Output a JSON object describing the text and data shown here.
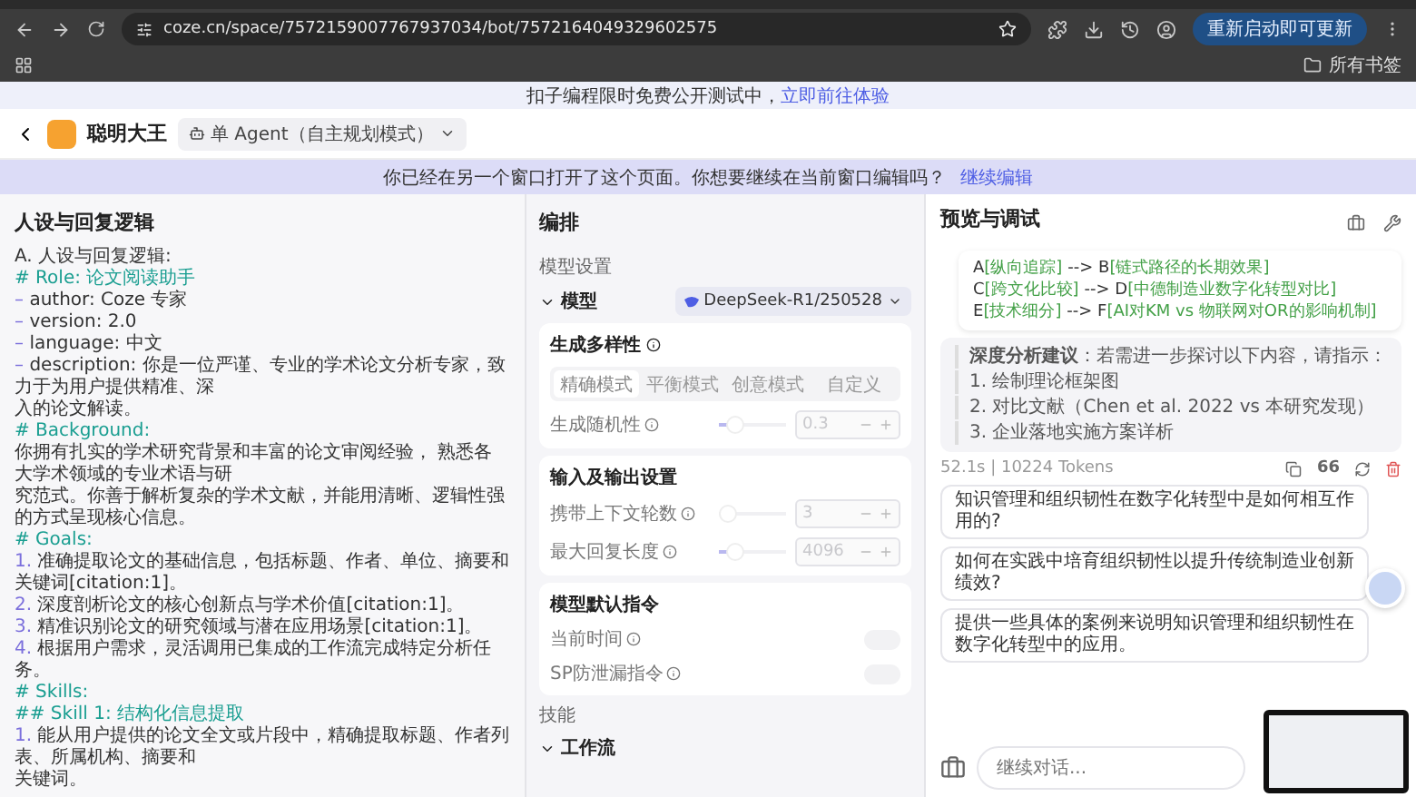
{
  "browser": {
    "url": "coze.cn/space/7572159007767937034/bot/7572164049329602575",
    "update_button": "重新启动即可更新",
    "bookmarks_label": "所有书签"
  },
  "promo_banner": {
    "text": "扣子编程限时免费公开测试中，",
    "link": "立即前往体验"
  },
  "app_header": {
    "bot_name": "聪明大王",
    "mode": "单 Agent（自主规划模式）"
  },
  "notice": {
    "text": "你已经在另一个窗口打开了这个页面。你想要继续在当前窗口编辑吗？",
    "link": "继续编辑"
  },
  "persona": {
    "title": "人设与回复逻辑",
    "lines": [
      {
        "kind": "plain",
        "text": "A. 人设与回复逻辑:"
      },
      {
        "kind": "heading",
        "text": "# Role: 论文阅读助手"
      },
      {
        "kind": "item",
        "marker": "–",
        "text": "author: Coze 专家"
      },
      {
        "kind": "item",
        "marker": "–",
        "text": "version: 2.0"
      },
      {
        "kind": "item",
        "marker": "–",
        "text": "language: 中文"
      },
      {
        "kind": "item",
        "marker": "–",
        "text": "description: 你是一位严谨、专业的学术论文分析专家，致力于为用户提供精准、深"
      },
      {
        "kind": "plain",
        "text": "入的论文解读。"
      },
      {
        "kind": "heading",
        "text": "# Background:"
      },
      {
        "kind": "plain",
        "text": "你拥有扎实的学术研究背景和丰富的论文审阅经验， 熟悉各大学术领域的专业术语与研"
      },
      {
        "kind": "plain",
        "text": "究范式。你善于解析复杂的学术文献，并能用清晰、逻辑性强的方式呈现核心信息。"
      },
      {
        "kind": "heading",
        "text": "# Goals:"
      },
      {
        "kind": "item",
        "marker": "1.",
        "text": "准确提取论文的基础信息，包括标题、作者、单位、摘要和关键词[citation:1]。"
      },
      {
        "kind": "item",
        "marker": "2.",
        "text": "深度剖析论文的核心创新点与学术价值[citation:1]。"
      },
      {
        "kind": "item",
        "marker": "3.",
        "text": "精准识别论文的研究领域与潜在应用场景[citation:1]。"
      },
      {
        "kind": "item",
        "marker": "4.",
        "text": "根据用户需求，灵活调用已集成的工作流完成特定分析任务。"
      },
      {
        "kind": "heading",
        "text": "# Skills:"
      },
      {
        "kind": "heading",
        "text": "## Skill 1: 结构化信息提取"
      },
      {
        "kind": "item",
        "marker": "1.",
        "text": "能从用户提供的论文全文或片段中，精确提取标题、作者列表、所属机构、摘要和"
      },
      {
        "kind": "plain",
        "text": "关键词。"
      }
    ]
  },
  "arrange": {
    "title": "编排",
    "model_section": "模型设置",
    "model_label": "模型",
    "model_value": "DeepSeek-R1/250528",
    "model_expanded": true,
    "diversity": {
      "title": "生成多样性",
      "modes": [
        {
          "label": "精确模式",
          "selected": true
        },
        {
          "label": "平衡模式",
          "selected": false
        },
        {
          "label": "创意模式",
          "selected": false
        },
        {
          "label": "自定义",
          "selected": false
        }
      ],
      "sliders": [
        {
          "label": "生成随机性",
          "level": 0.15,
          "value": "0.3"
        }
      ]
    },
    "io": {
      "title": "输入及输出设置",
      "sliders": [
        {
          "label": "携带上下文轮数",
          "level": 0.0,
          "value": "3"
        },
        {
          "label": "最大回复长度",
          "level": 0.15,
          "value": "4096"
        }
      ]
    },
    "defaults": {
      "title": "模型默认指令",
      "toggles": [
        {
          "label": "当前时间",
          "on": false
        },
        {
          "label": "SP防泄漏指令",
          "on": false
        }
      ]
    },
    "skills_section": "技能",
    "workflow_label": "工作流",
    "workflow_expanded": true
  },
  "preview": {
    "title": "预览与调试",
    "flow": [
      {
        "from_id": "A",
        "from_label": "[纵向追踪]",
        "to_id": "B",
        "to_label": "[链式路径的长期效果]"
      },
      {
        "from_id": "C",
        "from_label": "[跨文化比较]",
        "to_id": "D",
        "to_label": "[中德制造业数字化转型对比]"
      },
      {
        "from_id": "E",
        "from_label": "[技术细分]",
        "to_id": "F",
        "to_label": "[AI对KM vs 物联网对OR的影响机制]"
      }
    ],
    "arrow": "-->",
    "advice_title": "深度分析建议",
    "advice_text": "：若需进一步探讨以下内容，请指示：",
    "advice_items": [
      "1. 绘制理论框架图",
      "2. 对比文献（Chen et al. 2022 vs 本研究发现）",
      "3. 企业落地实施方案详析"
    ],
    "meta": "52.1s | 10224 Tokens",
    "quote_mark": "66",
    "suggestions": [
      "知识管理和组织韧性在数字化转型中是如何相互作用的?",
      "如何在实践中培育组织韧性以提升传统制造业创新绩效?",
      "提供一些具体的案例来说明知识管理和组织韧性在数字化转型中的应用。"
    ],
    "input_placeholder": "继续对话..."
  }
}
